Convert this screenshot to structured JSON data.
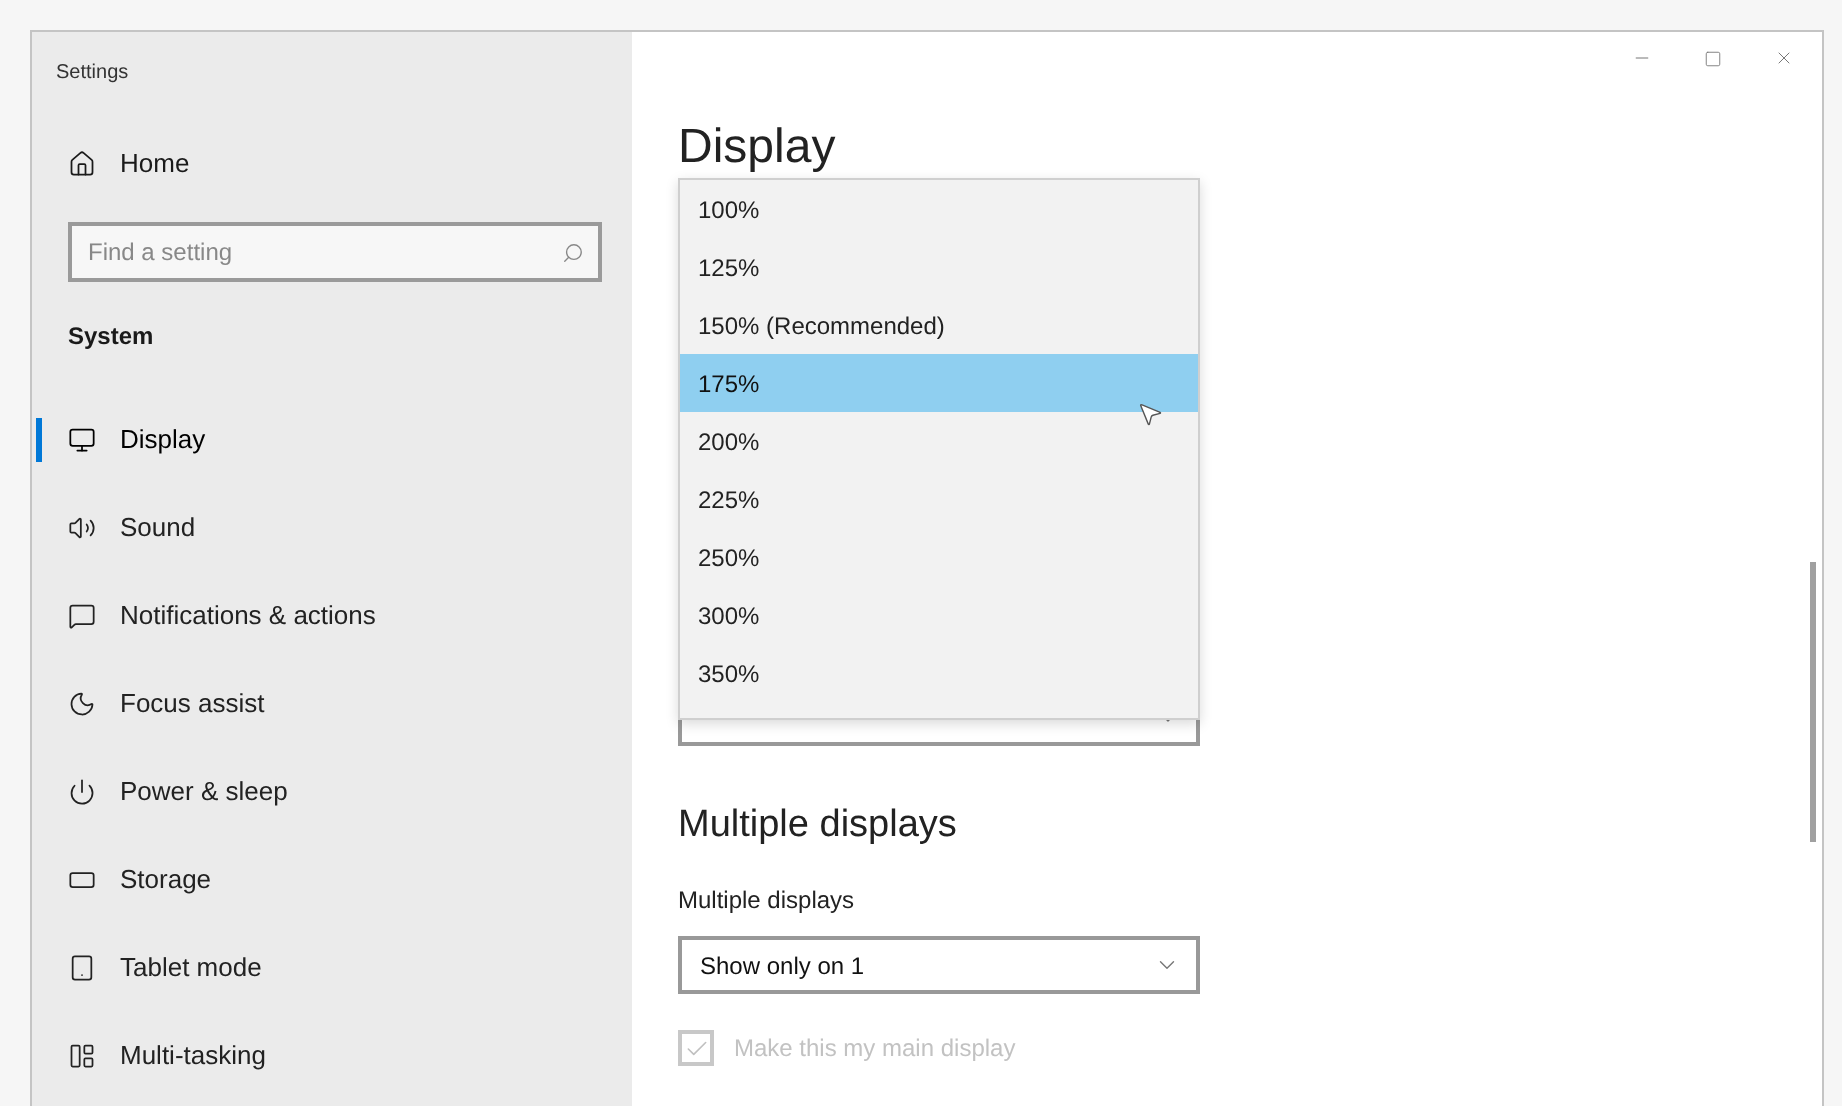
{
  "window": {
    "title": "Settings"
  },
  "sidebar": {
    "home": "Home",
    "search": {
      "placeholder": "Find a setting"
    },
    "section": "System",
    "items": [
      {
        "label": "Display",
        "selected": true
      },
      {
        "label": "Sound",
        "selected": false
      },
      {
        "label": "Notifications & actions",
        "selected": false
      },
      {
        "label": "Focus assist",
        "selected": false
      },
      {
        "label": "Power & sleep",
        "selected": false
      },
      {
        "label": "Storage",
        "selected": false
      },
      {
        "label": "Tablet mode",
        "selected": false
      },
      {
        "label": "Multi-tasking",
        "selected": false
      }
    ]
  },
  "content": {
    "heading": "Display",
    "scale_dropdown": {
      "options": [
        {
          "label": "100%",
          "selected": false
        },
        {
          "label": "125%",
          "selected": false
        },
        {
          "label": "150% (Recommended)",
          "selected": false
        },
        {
          "label": "175%",
          "selected": true
        },
        {
          "label": "200%",
          "selected": false
        },
        {
          "label": "225%",
          "selected": false
        },
        {
          "label": "250%",
          "selected": false
        },
        {
          "label": "300%",
          "selected": false
        },
        {
          "label": "350%",
          "selected": false
        }
      ]
    },
    "multiple_displays": {
      "heading": "Multiple displays",
      "label": "Multiple displays",
      "value": "Show only on 1",
      "checkbox": {
        "label": "Make this my main display",
        "checked": true,
        "disabled": true
      }
    }
  }
}
